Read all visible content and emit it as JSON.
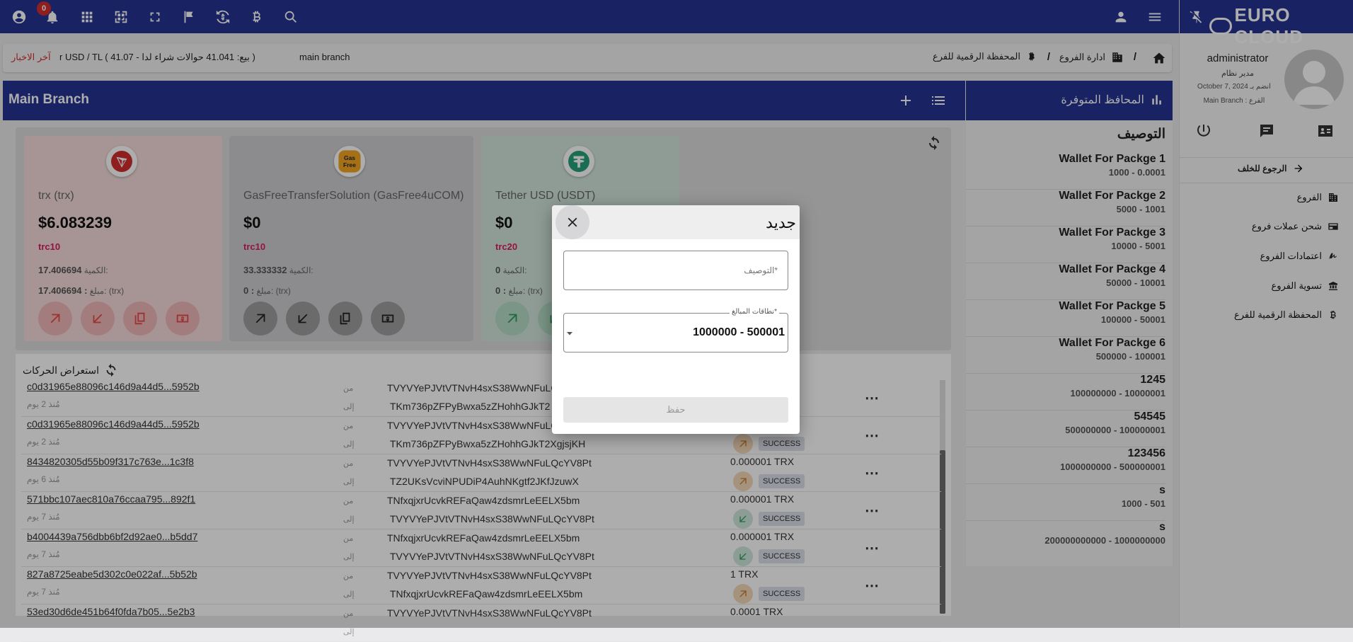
{
  "notifications": {
    "count": "0"
  },
  "brand": {
    "name": "EURO CLOUD"
  },
  "user": {
    "name": "administrator",
    "role": "مدير نظام",
    "joined": "October 7, 2024 انضم بـ",
    "branch": "Main Branch : الفرع"
  },
  "sidebar": {
    "back_label": "الرجوع للخلف",
    "items": [
      {
        "label": "الفروع",
        "icon": "building-icon"
      },
      {
        "label": "شحن عملات فروع",
        "icon": "charge-card-icon"
      },
      {
        "label": "اعتمادات الفروع",
        "icon": "signature-icon"
      },
      {
        "label": "تسوية الفروع",
        "icon": "settlement-icon"
      },
      {
        "label": "المحفظة الرقمية للفرع",
        "icon": "bitcoin-icon"
      }
    ]
  },
  "breadcrumb": {
    "items": [
      "ادارة الفروع",
      "المحفظة الرقمية للفرع"
    ]
  },
  "ticker": {
    "news_label": "آخر الاخبار",
    "text": "r  USD / TL ( 41.07 - بيع: 41.041 حوالات شراء لدا )",
    "branch": "main branch"
  },
  "main_header": {
    "title": "Main Branch"
  },
  "wallets_header": {
    "title": "المحافظ المتوفرة"
  },
  "wallets": {
    "column_title": "التوصيف",
    "items": [
      {
        "name": "Wallet For Packge 1",
        "range": "1000 - 0.0001"
      },
      {
        "name": "Wallet For Packge 2",
        "range": "5000 - 1001"
      },
      {
        "name": "Wallet For Packge 3",
        "range": "10000 - 5001"
      },
      {
        "name": "Wallet For Packge 4",
        "range": "50000 - 10001"
      },
      {
        "name": "Wallet For Packge 5",
        "range": "100000 - 50001"
      },
      {
        "name": "Wallet For Packge 6",
        "range": "500000 - 100001"
      },
      {
        "name": "1245",
        "range": "100000000 - 10000001"
      },
      {
        "name": "54545",
        "range": "500000000 - 100000001"
      },
      {
        "name": "123456",
        "range": "1000000000 - 500000001"
      },
      {
        "name": "s",
        "range": "1000 - 501"
      },
      {
        "name": "s",
        "range": "200000000000 - 1000000000"
      }
    ]
  },
  "cards": [
    {
      "name": "trx (trx)",
      "value": "$6.083239",
      "network": "trc10",
      "qty_label": "الكمية:",
      "qty": "17.406694",
      "amt_label": "مبلغ: (trx)",
      "amt": "17.406694 :",
      "icon": "tron-icon",
      "color": "#f6dcdc"
    },
    {
      "name": "GasFreeTransferSolution (GasFree4uCOM)",
      "value": "$0",
      "network": "trc10",
      "qty_label": "الكمية:",
      "qty": "33.333332",
      "amt_label": "مبلغ: (trx)",
      "amt": "0 :",
      "icon": "gasfree-icon",
      "color": "#cfcfd1"
    },
    {
      "name": "Tether USD (USDT)",
      "value": "$0",
      "network": "trc20",
      "qty_label": "الكمية:",
      "qty": "0",
      "amt_label": "مبلغ: (trx)",
      "amt": "0 :",
      "icon": "tether-icon",
      "color": "#d3e6dd"
    }
  ],
  "transactions": {
    "title": "استعراض الحركات",
    "from_label": "من",
    "to_label": "إلى",
    "rows": [
      {
        "hash": "c0d31965e88096c146d9a44d5...5952b",
        "ago": "مُنذ 2 يوم",
        "from": "TVYVYePJVtVTNvH4sxS38WwNFuLQ",
        "to": "TKm736pZFPyBwxa5zZHohhGJkT2",
        "amount": "",
        "dir": "out",
        "status": ""
      },
      {
        "hash": "c0d31965e88096c146d9a44d5...5952b",
        "ago": "مُنذ 2 يوم",
        "from": "TVYVYePJVtVTNvH4sxS38WwNFuLQ",
        "to": "TKm736pZFPyBwxa5zZHohhGJkT2XgjsjKH",
        "amount": "",
        "dir": "out",
        "status": "SUCCESS"
      },
      {
        "hash": "8434820305d55b09f317c763e...1c3f8",
        "ago": "مُنذ 6 يوم",
        "from": "TVYVYePJVtVTNvH4sxS38WwNFuLQcYV8Pt",
        "to": "TZ2UKsVcviNPUDiP4AuhNKgtf2JKfJzuwX",
        "amount": "0.000001  TRX",
        "dir": "out",
        "status": "SUCCESS"
      },
      {
        "hash": "571bbc107aec810a76ccaa795...892f1",
        "ago": "مُنذ 7 يوم",
        "from": "TNfxqjxrUcvkREFaQaw4zdsmrLeEELX5bm",
        "to": "TVYVYePJVtVTNvH4sxS38WwNFuLQcYV8Pt",
        "amount": "0.000001  TRX",
        "dir": "in",
        "status": "SUCCESS"
      },
      {
        "hash": "b4004439a756dbb6bf2d92ae0...b5dd7",
        "ago": "مُنذ 7 يوم",
        "from": "TNfxqjxrUcvkREFaQaw4zdsmrLeEELX5bm",
        "to": "TVYVYePJVtVTNvH4sxS38WwNFuLQcYV8Pt",
        "amount": "0.000001  TRX",
        "dir": "in",
        "status": "SUCCESS"
      },
      {
        "hash": "827a8725eabe5d302c0e022af...5b52b",
        "ago": "مُنذ 7 يوم",
        "from": "TVYVYePJVtVTNvH4sxS38WwNFuLQcYV8Pt",
        "to": "TNfxqjxrUcvkREFaQaw4zdsmrLeEELX5bm",
        "amount": "1  TRX",
        "dir": "out",
        "status": "SUCCESS"
      },
      {
        "hash": "53ed30d6de451b64f0fda7b05...5e2b3",
        "ago": "",
        "from": "TVYVYePJVtVTNvH4sxS38WwNFuLQcYV8Pt",
        "to": "",
        "amount": "0.0001  TRX",
        "dir": "",
        "status": ""
      }
    ]
  },
  "modal": {
    "title": "جديد",
    "desc_placeholder": "التوصيف*",
    "range_label": "نطاقات المبالغ*",
    "range_value": "1000000 - 500001",
    "save_label": "حفظ"
  }
}
